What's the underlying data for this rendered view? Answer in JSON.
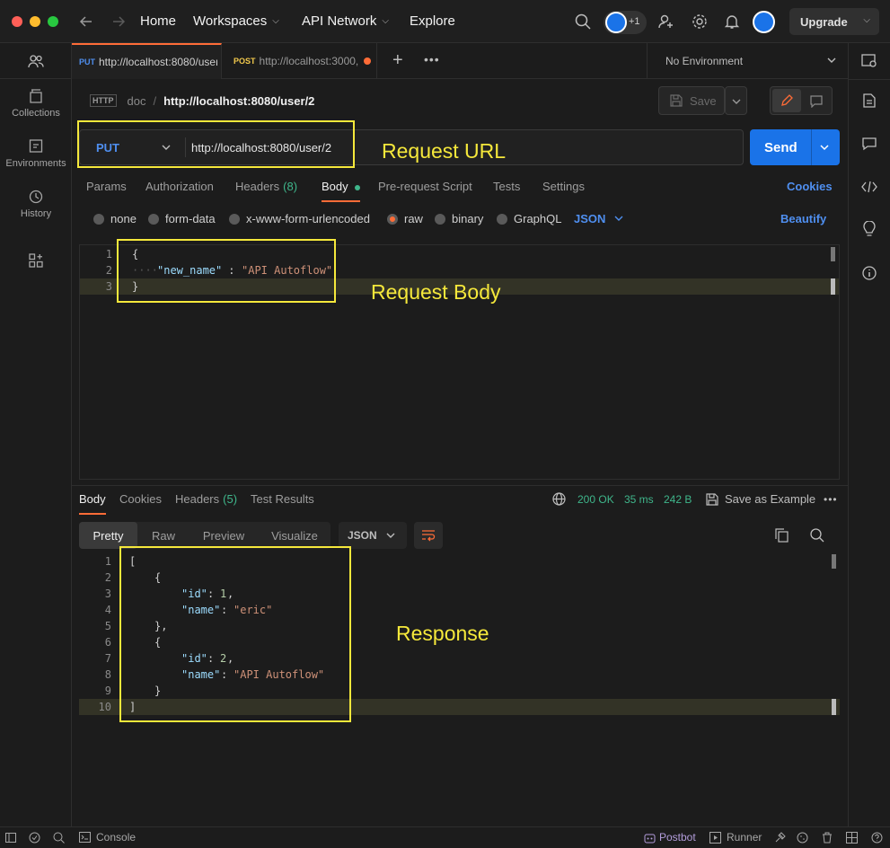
{
  "titlebar": {
    "nav": {
      "home": "Home",
      "workspaces": "Workspaces",
      "api_network": "API Network",
      "explore": "Explore"
    },
    "avatar_extra": "+1",
    "upgrade": "Upgrade"
  },
  "leftbar": {
    "items": [
      {
        "label": "Collections"
      },
      {
        "label": "Environments"
      },
      {
        "label": "History"
      }
    ]
  },
  "tabs": [
    {
      "method": "PUT",
      "url": "http://localhost:8080/user",
      "method_color": "#4f8ff0"
    },
    {
      "method": "POST",
      "url": "http://localhost:3000,",
      "method_color": "#f2c94c"
    }
  ],
  "environment": "No Environment",
  "breadcrumb": {
    "collection": "doc",
    "separator": "/",
    "request": "http://localhost:8080/user/2"
  },
  "save_label": "Save",
  "request": {
    "method": "PUT",
    "url": "http://localhost:8080/user/2",
    "send": "Send",
    "subtabs": {
      "params": "Params",
      "authorization": "Authorization",
      "headers": "Headers",
      "headers_count": "(8)",
      "body": "Body",
      "pre_request": "Pre-request Script",
      "tests": "Tests",
      "settings": "Settings",
      "cookies": "Cookies"
    },
    "body_modes": {
      "none": "none",
      "form_data": "form-data",
      "urlencoded": "x-www-form-urlencoded",
      "raw": "raw",
      "binary": "binary",
      "graphql": "GraphQL",
      "format": "JSON",
      "beautify": "Beautify"
    },
    "body_lines": {
      "n1": "1",
      "n2": "2",
      "n3": "3",
      "open": "{",
      "key": "\"new_name\"",
      "colon": " : ",
      "value": "\"API Autoflow\"",
      "close": "}"
    }
  },
  "response": {
    "tabs": {
      "body": "Body",
      "cookies": "Cookies",
      "headers": "Headers",
      "headers_count": "(5)",
      "tests": "Test Results"
    },
    "status": "200 OK",
    "time": "35 ms",
    "size": "242 B",
    "save_example": "Save as Example",
    "views": {
      "pretty": "Pretty",
      "raw": "Raw",
      "preview": "Preview",
      "visualize": "Visualize",
      "format": "JSON"
    },
    "lines": {
      "n1": "1",
      "n2": "2",
      "n3": "3",
      "n4": "4",
      "n5": "5",
      "n6": "6",
      "n7": "7",
      "n8": "8",
      "n9": "9",
      "n10": "10",
      "l1": "[",
      "l2": "{",
      "k_id": "\"id\"",
      "v_id1": "1",
      "k_name": "\"name\"",
      "v_name1": "\"eric\"",
      "l5": "},",
      "l6": "{",
      "v_id2": "2",
      "v_name2": "\"API Autoflow\"",
      "l9": "}",
      "l10": "]",
      "colon": ": ",
      "comma": ","
    }
  },
  "annotations": {
    "request_url": "Request URL",
    "request_body": "Request Body",
    "response": "Response"
  },
  "statusbar": {
    "console": "Console",
    "postbot": "Postbot",
    "runner": "Runner"
  },
  "colors": {
    "accent_blue": "#1a73e8",
    "annotation": "#f5e83b",
    "status_ok": "#3fb68b",
    "tab_active": "#ff6c37"
  }
}
